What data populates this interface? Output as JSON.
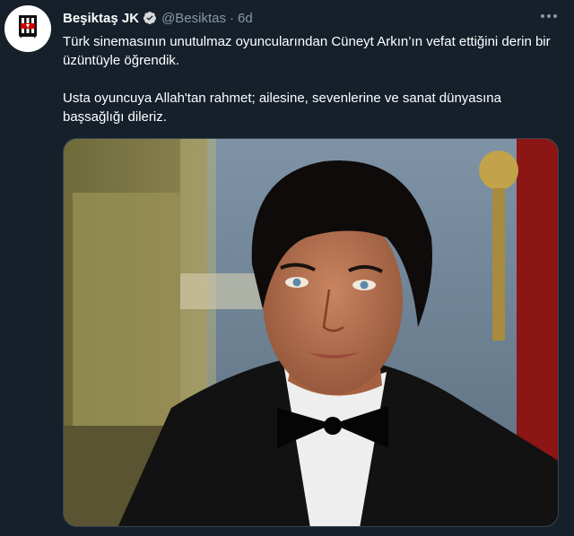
{
  "author": {
    "name": "Beşiktaş JK",
    "handle": "@Besiktas",
    "separator": "·",
    "time": "6d"
  },
  "tweet": {
    "paragraph1": "Türk sinemasının unutulmaz oyuncularından Cüneyt Arkın’ın vefat ettiğini derin bir üzüntüyle öğrendik.",
    "paragraph2": "Usta oyuncuya Allah'tan rahmet; ailesine, sevenlerine ve sanat dünyasına başsağlığı dileriz."
  },
  "avatar_logo_text": "BJK 1903",
  "icons": {
    "verified": "verified-badge-icon",
    "more": "more-options-icon"
  },
  "colors": {
    "background": "#15202b",
    "name": "#ffffff",
    "secondary": "#8899a6",
    "verified": "#1d9bf0"
  }
}
